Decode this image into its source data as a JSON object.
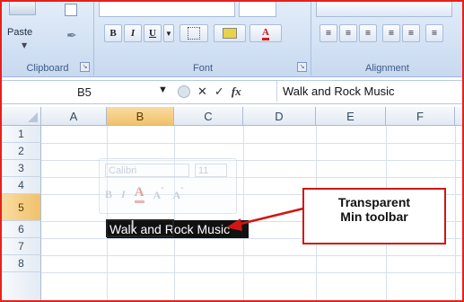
{
  "ribbon": {
    "clipboard": {
      "paste_label": "Paste",
      "group_label": "Clipboard"
    },
    "font": {
      "group_label": "Font",
      "bold": "B",
      "italic": "I",
      "underline": "U",
      "font_color": "A"
    },
    "alignment": {
      "group_label": "Alignment"
    }
  },
  "formula_bar": {
    "name_box": "B5",
    "fx": "fx",
    "content": "Walk and Rock Music"
  },
  "columns": [
    "A",
    "B",
    "C",
    "D",
    "E",
    "F"
  ],
  "rows": [
    "1",
    "2",
    "3",
    "4",
    "5",
    "6",
    "7",
    "8"
  ],
  "selected_cell": {
    "column": "B",
    "row": "5",
    "value": "Walk and Rock Music"
  },
  "mini_toolbar": {
    "font_name": "Calibri",
    "font_size": "11",
    "bold": "B",
    "italic": "I",
    "font_color": "A",
    "grow": "A",
    "shrink": "A"
  },
  "callout": {
    "line1": "Transparent",
    "line2": "Min toolbar"
  },
  "colors": {
    "border": "#e8201c",
    "selected_header": "#f1c16a",
    "callout_border": "#d01616"
  }
}
